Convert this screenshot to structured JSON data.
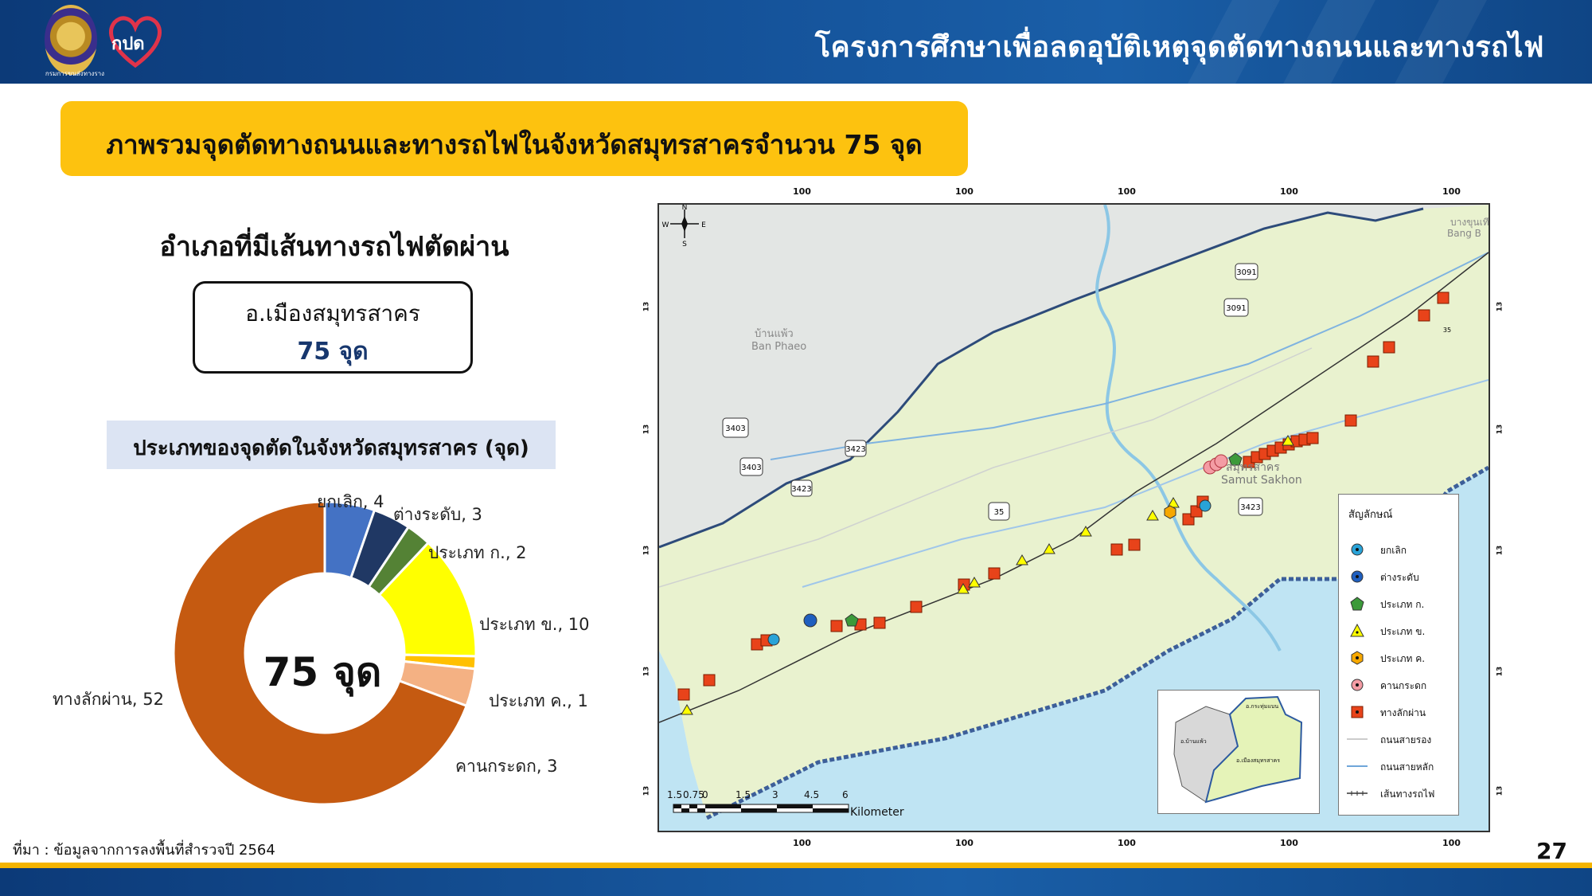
{
  "header": {
    "title": "โครงการศึกษาเพื่อลดอุบัติเหตุจุดตัดทางถนนและทางรถไฟ",
    "dept_logo_caption": "กรมการขนส่งทางราง",
    "kpd_logo_text": "กปด"
  },
  "banner": {
    "title": "ภาพรวมจุดตัดทางถนนและทางรถไฟในจังหวัดสมุทรสาครจำนวน 75 จุด"
  },
  "district": {
    "heading": "อำเภอที่มีเส้นทางรถไฟตัดผ่าน",
    "name": "อ.เมืองสมุทรสาคร",
    "count": "75 จุด"
  },
  "donut": {
    "caption": "ประเภทของจุดตัดในจังหวัดสมุทรสาคร (จุด)",
    "center": "75 จุด"
  },
  "chart_data": {
    "type": "pie",
    "categories": [
      "ยกเลิก",
      "ต่างระดับ",
      "ประเภท ก.",
      "ประเภท ข.",
      "ประเภท ค.",
      "คานกระดก",
      "ทางลักผ่าน"
    ],
    "values": [
      4,
      3,
      2,
      10,
      1,
      3,
      52
    ],
    "labels": [
      "ยกเลิก, 4",
      "ต่างระดับ, 3",
      "ประเภท ก., 2",
      "ประเภท ข., 10",
      "ประเภท ค., 1",
      "คานกระดก, 3",
      "ทางลักผ่าน, 52"
    ],
    "colors": [
      "#4472c4",
      "#203864",
      "#548235",
      "#ffff00",
      "#ffc000",
      "#f4b183",
      "#c55a11"
    ],
    "total_label": "75 จุด"
  },
  "map": {
    "place_labels": [
      "บ้านแพ้ว",
      "Ban Phaeo",
      "สมุทรสาคร",
      "Samut Sakhon",
      "บางขุนเทียน",
      "Bang B"
    ],
    "route_shields": [
      "3091",
      "3091",
      "3403",
      "3403",
      "3423",
      "3423",
      "3423",
      "35",
      "35"
    ],
    "top_coords": [
      "100",
      "100",
      "100",
      "100",
      "100"
    ],
    "side_coords": [
      "13",
      "13",
      "13",
      "13",
      "13"
    ],
    "compass": [
      "N",
      "S",
      "W",
      "E"
    ],
    "scale": {
      "ticks": [
        "1.5",
        "0.75",
        "0",
        "1.5",
        "3",
        "4.5",
        "6"
      ],
      "unit": "Kilometers"
    },
    "inset_labels": [
      "อ.กระทุ่มแบน",
      "อ.บ้านแพ้ว",
      "อ.เมืองสมุทรสาคร"
    ],
    "legend": {
      "title": "สัญลักษณ์",
      "items": [
        {
          "label": "ยกเลิก",
          "color": "#29a3d8",
          "shape": "circle"
        },
        {
          "label": "ต่างระดับ",
          "color": "#1f5fbf",
          "shape": "circle"
        },
        {
          "label": "ประเภท ก.",
          "color": "#3c9a3a",
          "shape": "pentagon"
        },
        {
          "label": "ประเภท ข.",
          "color": "#ffff00",
          "shape": "triangle"
        },
        {
          "label": "ประเภท ค.",
          "color": "#f7a800",
          "shape": "hexagon"
        },
        {
          "label": "คานกระดก",
          "color": "#f49ca4",
          "shape": "circle"
        },
        {
          "label": "ทางลักผ่าน",
          "color": "#e8431a",
          "shape": "square"
        },
        {
          "label": "ถนนสายรอง",
          "color": "#cccccc",
          "shape": "line"
        },
        {
          "label": "ถนนสายหลัก",
          "color": "#6fa6d9",
          "shape": "line"
        },
        {
          "label": "เส้นทางรถไฟ",
          "color": "#333333",
          "shape": "rail"
        }
      ]
    }
  },
  "footer": {
    "source": "ที่มา : ข้อมูลจากการลงพื้นที่สำรวจปี 2564",
    "page_number": "27"
  }
}
